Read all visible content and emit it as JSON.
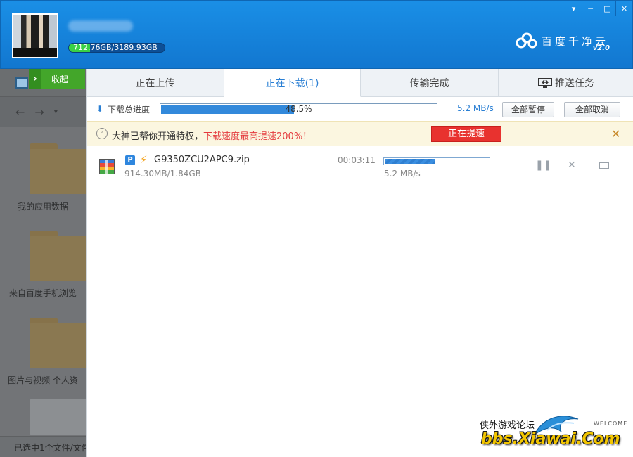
{
  "header": {
    "quota_text": "712.76GB/3189.93GB",
    "quota_fraction": 0.223,
    "brand_name": "百度千净云",
    "brand_version": "v2.0",
    "window_buttons": [
      "▾",
      "─",
      "□",
      "✕"
    ]
  },
  "sidebar": {
    "collapse_label": "收起",
    "folders": [
      {
        "label": "我的应用数据"
      },
      {
        "label": "来自百度手机浏览"
      },
      {
        "label": "图片与视频  个人资"
      }
    ],
    "status": "已选中1个文件/文件"
  },
  "transfer": {
    "tabs": [
      {
        "label": "正在上传"
      },
      {
        "label": "正在下载(1)"
      },
      {
        "label": "传输完成"
      },
      {
        "label": "推送任务"
      }
    ],
    "progress_label": "下载总进度",
    "progress_value": 0.485,
    "progress_text": "48.5%",
    "speed": "5.2 MB/s",
    "pause_all": "全部暂停",
    "cancel_all": "全部取消"
  },
  "notice": {
    "text": "大神已帮你开通特权，",
    "highlight": "下载速度最高提速200%！",
    "button": "正在提速"
  },
  "file": {
    "name": "G9350ZCU2APC9.zip",
    "size": "914.30MB/1.84GB",
    "time": "00:03:11",
    "progress_value": 0.485,
    "speed": "5.2 MB/s"
  },
  "watermark": {
    "site_name": "侠外游戏论坛",
    "welcome": "WELCOME",
    "url": "bbs.Xiawai.Com"
  },
  "colors": {
    "header_blue": "#1a8fe6",
    "accent_blue": "#2a7fd4",
    "quota_green": "#3ad146",
    "speedup_red": "#e8322f"
  }
}
